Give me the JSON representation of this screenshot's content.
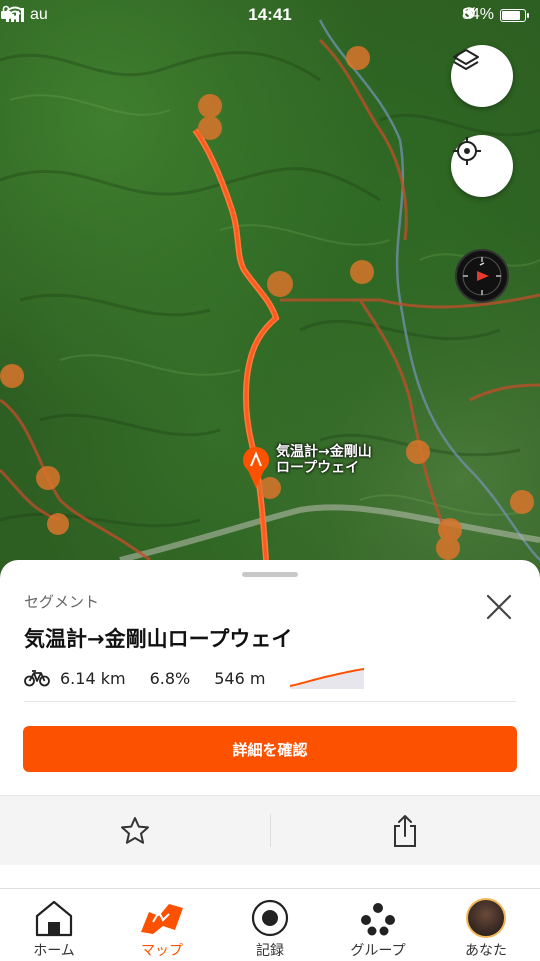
{
  "status_bar": {
    "carrier": "au",
    "time": "14:41",
    "battery": "84%"
  },
  "map": {
    "segment_label_line1": "気温計→金剛山",
    "segment_label_line2": "ロープウェイ"
  },
  "sheet": {
    "kicker": "セグメント",
    "title": "気温計→金剛山ロープウェイ",
    "distance": "6.14 km",
    "grade": "6.8%",
    "elevation": "546 m",
    "cta_label": "詳細を確認"
  },
  "tabs": [
    {
      "label": "ホーム",
      "icon": "home-icon"
    },
    {
      "label": "マップ",
      "icon": "map-icon",
      "active": true
    },
    {
      "label": "記録",
      "icon": "record-icon"
    },
    {
      "label": "グループ",
      "icon": "groups-icon"
    },
    {
      "label": "あなた",
      "icon": "avatar"
    }
  ],
  "colors": {
    "accent": "#fc5200",
    "route": "#ff5a1f"
  }
}
